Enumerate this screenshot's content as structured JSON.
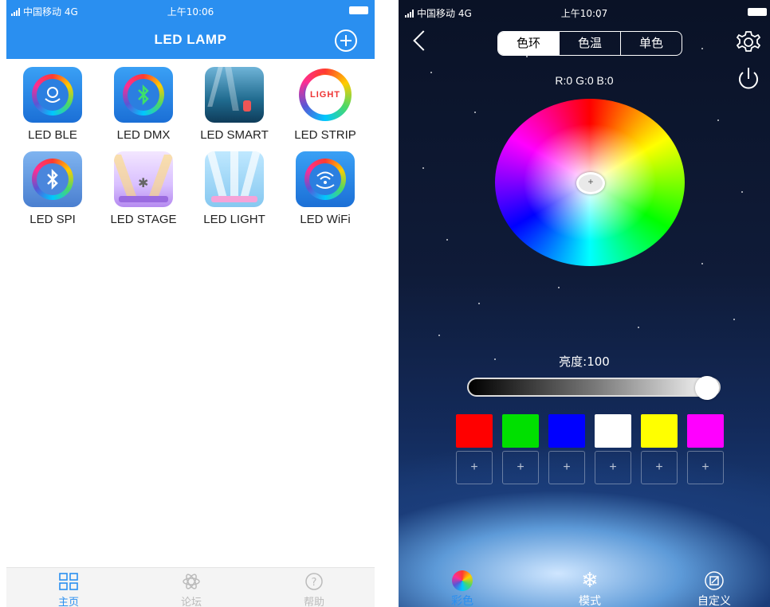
{
  "left": {
    "status": {
      "carrier": "中国移动 4G",
      "time": "上午10:06"
    },
    "header": {
      "title": "LED LAMP"
    },
    "apps": [
      {
        "label": "LED BLE",
        "icon": "led-ble-icon"
      },
      {
        "label": "LED DMX",
        "icon": "led-dmx-icon"
      },
      {
        "label": "LED SMART",
        "icon": "led-smart-icon"
      },
      {
        "label": "LED STRIP",
        "icon": "led-strip-icon",
        "badge": "LIGHT"
      },
      {
        "label": "LED SPI",
        "icon": "led-spi-icon"
      },
      {
        "label": "LED STAGE",
        "icon": "led-stage-icon"
      },
      {
        "label": "LED LIGHT",
        "icon": "led-light-icon"
      },
      {
        "label": "LED WiFi",
        "icon": "led-wifi-icon"
      }
    ],
    "tabs": [
      {
        "label": "主页",
        "icon": "home-grid-icon",
        "active": true
      },
      {
        "label": "论坛",
        "icon": "forum-icon",
        "active": false
      },
      {
        "label": "帮助",
        "icon": "help-icon",
        "active": false
      }
    ],
    "accent": "#2a8ff0"
  },
  "right": {
    "status": {
      "carrier": "中国移动 4G",
      "time": "上午10:07"
    },
    "segments": [
      "色环",
      "色温",
      "单色"
    ],
    "rgb": "R:0 G:0 B:0",
    "brightness_label": "亮度:100",
    "brightness": 100,
    "swatches": [
      "#ff0000",
      "#00e000",
      "#0000ff",
      "#ffffff",
      "#ffff00",
      "#ff00ff"
    ],
    "preset_label": "+",
    "tabs": [
      {
        "label": "彩色",
        "icon": "color-ball-icon"
      },
      {
        "label": "模式",
        "icon": "snowflake-icon"
      },
      {
        "label": "自定义",
        "icon": "edit-icon"
      }
    ]
  }
}
